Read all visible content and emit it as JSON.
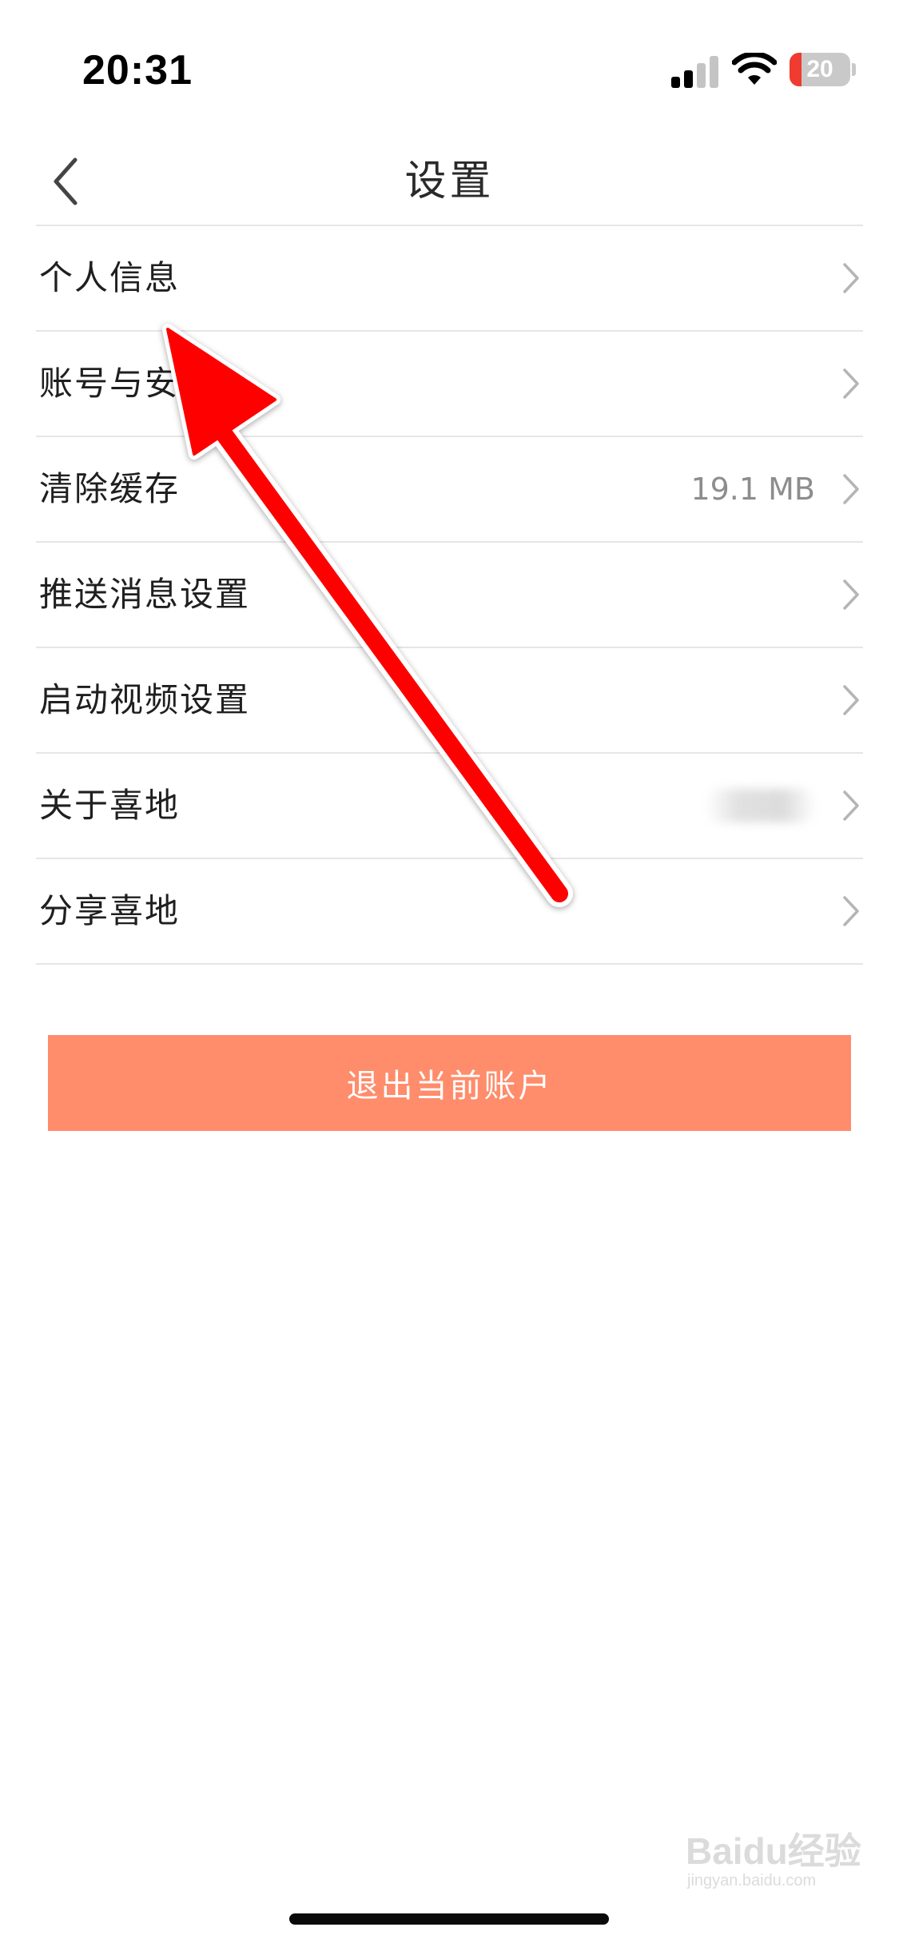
{
  "status_bar": {
    "time": "20:31",
    "battery_percent": "20",
    "battery_level": 0.2,
    "signal_bars_active": 2,
    "signal_bars_total": 4,
    "battery_color": "#ef3b30"
  },
  "nav": {
    "back_icon": "chevron-left-icon",
    "title": "设置"
  },
  "settings": {
    "items": [
      {
        "label": "个人信息",
        "value": ""
      },
      {
        "label": "账号与安全",
        "value": ""
      },
      {
        "label": "清除缓存",
        "value": "19.1 MB"
      },
      {
        "label": "推送消息设置",
        "value": ""
      },
      {
        "label": "启动视频设置",
        "value": ""
      },
      {
        "label": "关于喜地",
        "value": "",
        "value_blurred": true
      },
      {
        "label": "分享喜地",
        "value": ""
      }
    ],
    "chevron_icon": "chevron-right-icon"
  },
  "logout": {
    "label": "退出当前账户",
    "color": "#ff8c6b"
  },
  "annotation": {
    "type": "arrow",
    "color": "#ff0000",
    "points_to": "个人信息"
  },
  "watermark": {
    "text": "Baidu经验",
    "subtext": "jingyan.baidu.com"
  }
}
